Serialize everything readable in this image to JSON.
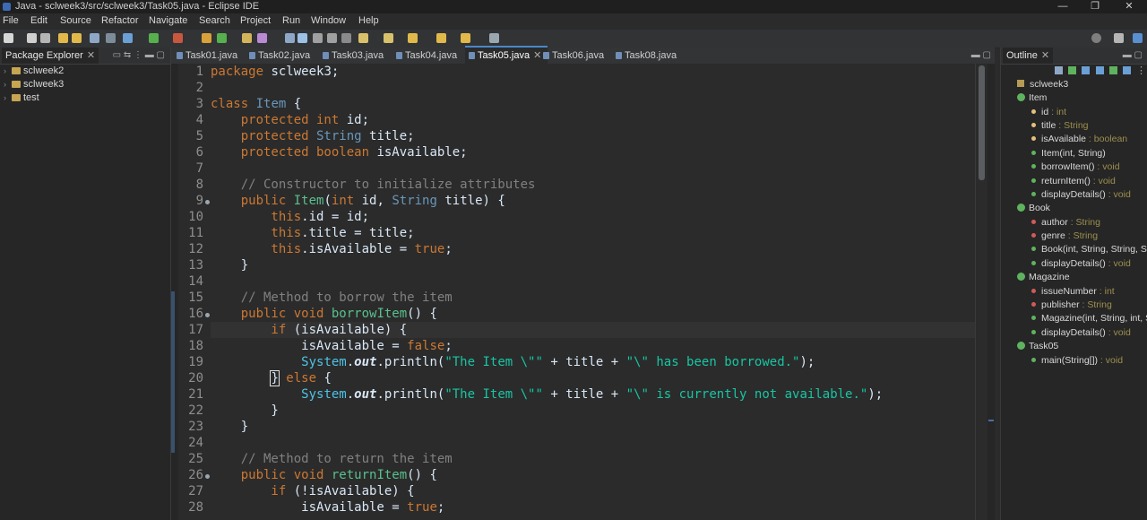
{
  "window": {
    "title": "Java - sclweek3/src/sclweek3/Task05.java - Eclipse IDE",
    "minimize": "—",
    "maximize": "❐",
    "close": "✕"
  },
  "menu": [
    "File",
    "Edit",
    "Source",
    "Refactor",
    "Navigate",
    "Search",
    "Project",
    "Run",
    "Window",
    "Help"
  ],
  "package_explorer": {
    "tab_label": "Package Explorer",
    "projects": [
      "sclweek2",
      "sclweek3",
      "test"
    ]
  },
  "editor": {
    "tabs": [
      "Task01.java",
      "Task02.java",
      "Task03.java",
      "Task04.java",
      "Task05.java",
      "Task06.java",
      "Task08.java"
    ],
    "active_tab": "Task05.java",
    "line_numbers": [
      "1",
      "2",
      "3",
      "4",
      "5",
      "6",
      "7",
      "8",
      "9",
      "10",
      "11",
      "12",
      "13",
      "14",
      "15",
      "16",
      "17",
      "18",
      "19",
      "20",
      "21",
      "22",
      "23",
      "24",
      "25",
      "26",
      "27",
      "28"
    ],
    "current_line": "17",
    "code": {
      "l1_kw": "package",
      "l1_rest": " sclweek3;",
      "l3_kw": "class",
      "l3_name": " Item",
      "l3_rest": " {",
      "l4_kw": "    protected int",
      "l4_rest": " id;",
      "l5_kw": "    protected",
      "l5_type": " String",
      "l5_rest": " title;",
      "l6_kw": "    protected boolean",
      "l6_rest": " isAvailable;",
      "l8_comment": "    // Constructor to initialize attributes",
      "l9_kw": "    public",
      "l9_fn": " Item",
      "l9_a": "(",
      "l9_kw2": "int",
      "l9_b": " id, ",
      "l9_ty": "String",
      "l9_c": " title) {",
      "l10_kw": "        this",
      "l10_rest": ".id = id;",
      "l11_kw": "        this",
      "l11_rest": ".title = title;",
      "l12_kw": "        this",
      "l12_rest": ".isAvailable = ",
      "l12_val": "true",
      "l12_end": ";",
      "l13": "    }",
      "l15_comment": "    // Method to borrow the item",
      "l16_kw": "    public void",
      "l16_fn": " borrowItem",
      "l16_rest": "() {",
      "l17_kw": "        if",
      "l17_rest": " (isAvailable) {",
      "l18_a": "            isAvailable = ",
      "l18_val": "false",
      "l18_end": ";",
      "l19_pre": "            ",
      "l19_sys": "System",
      "l19_dot": ".",
      "l19_out": "out",
      "l19_call": ".println(",
      "l19_s1": "\"The Item \\\"\"",
      "l19_plus1": " + title + ",
      "l19_s2": "\"\\\" has been borrowed.\"",
      "l19_end": ");",
      "l20_pre": "        ",
      "l20_brace": "}",
      "l20_kw": " else",
      "l20_rest": " {",
      "l21_pre": "            ",
      "l21_sys": "System",
      "l21_dot": ".",
      "l21_out": "out",
      "l21_call": ".println(",
      "l21_s1": "\"The Item \\\"\"",
      "l21_plus1": " + title + ",
      "l21_s2": "\"\\\" is currently not available.\"",
      "l21_end": ");",
      "l22": "        }",
      "l23": "    }",
      "l25_comment": "    // Method to return the item",
      "l26_kw": "    public void",
      "l26_fn": " returnItem",
      "l26_rest": "() {",
      "l27_kw": "        if",
      "l27_rest": " (!isAvailable) {",
      "l28_a": "            isAvailable = ",
      "l28_val": "true",
      "l28_end": ";"
    }
  },
  "outline": {
    "tab_label": "Outline",
    "package": "sclweek3",
    "classes": [
      {
        "name": "Item",
        "members": [
          {
            "name": "id",
            "type": " : int",
            "vis": "protected"
          },
          {
            "name": "title",
            "type": " : String",
            "vis": "protected"
          },
          {
            "name": "isAvailable",
            "type": " : boolean",
            "vis": "protected"
          },
          {
            "name": "Item(int, String)",
            "type": "",
            "vis": "public"
          },
          {
            "name": "borrowItem()",
            "type": " : void",
            "vis": "public"
          },
          {
            "name": "returnItem()",
            "type": " : void",
            "vis": "public"
          },
          {
            "name": "displayDetails()",
            "type": " : void",
            "vis": "public"
          }
        ]
      },
      {
        "name": "Book",
        "members": [
          {
            "name": "author",
            "type": " : String",
            "vis": "private"
          },
          {
            "name": "genre",
            "type": " : String",
            "vis": "private"
          },
          {
            "name": "Book(int, String, String, Str",
            "type": "",
            "vis": "public"
          },
          {
            "name": "displayDetails()",
            "type": " : void",
            "vis": "public"
          }
        ]
      },
      {
        "name": "Magazine",
        "members": [
          {
            "name": "issueNumber",
            "type": " : int",
            "vis": "private"
          },
          {
            "name": "publisher",
            "type": " : String",
            "vis": "private"
          },
          {
            "name": "Magazine(int, String, int, S",
            "type": "",
            "vis": "public"
          },
          {
            "name": "displayDetails()",
            "type": " : void",
            "vis": "public"
          }
        ]
      },
      {
        "name": "Task05",
        "members": [
          {
            "name": "main(String[])",
            "type": " : void",
            "vis": "public"
          }
        ]
      }
    ]
  },
  "colors": {
    "background": "#2b2b2b",
    "keyword": "#cc7832",
    "type": "#6897bb",
    "method": "#59c08f",
    "string": "#17c6a3",
    "comment": "#808080"
  }
}
